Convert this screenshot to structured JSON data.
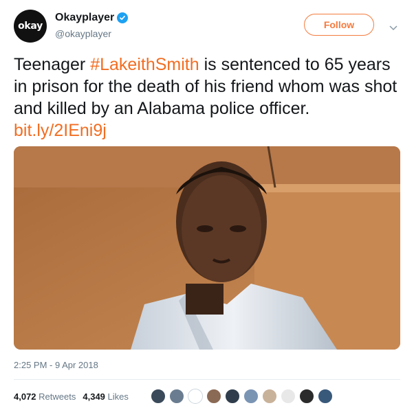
{
  "account": {
    "avatar_text": "okay",
    "display_name": "Okayplayer",
    "handle": "@okayplayer",
    "verified": true
  },
  "follow_button": {
    "label": "Follow"
  },
  "tweet": {
    "text_before_hashtag": "Teenager ",
    "hashtag": "#LakeithSmith",
    "text_after_hashtag": " is sentenced to 65 years in prison for the death of his friend whom was shot and killed by an Alabama police officer. ",
    "link": "bit.ly/2IEni9j",
    "link_color": "#f26d21"
  },
  "timestamp": "2:25 PM - 9 Apr 2018",
  "stats": {
    "retweets_count": "4,072",
    "retweets_label": "Retweets",
    "likes_count": "4,349",
    "likes_label": "Likes"
  },
  "likers": [
    "#3b4a5a",
    "#6a7d90",
    "#ffffff",
    "#8a6a55",
    "#2f3d4c",
    "#7a94b4",
    "#c9b29a",
    "#e8e8e8",
    "#2b2b2b",
    "#39597a"
  ],
  "colors": {
    "accent": "#f57a3d",
    "verified": "#1da1f2",
    "secondary_text": "#657786"
  }
}
